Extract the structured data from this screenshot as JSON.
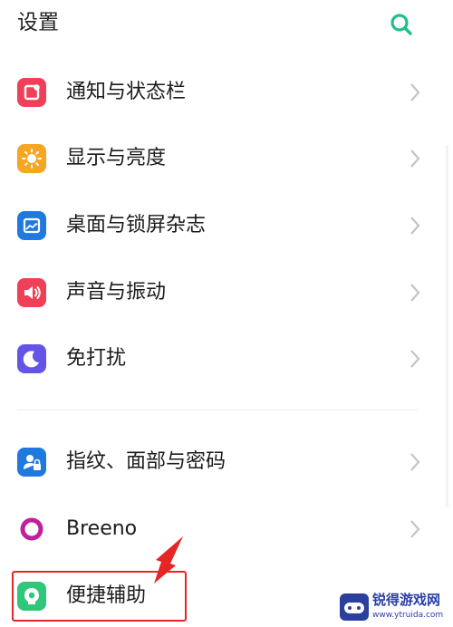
{
  "header": {
    "title": "设置",
    "search_icon": "search-icon"
  },
  "colors": {
    "accent": "#1fbf8f",
    "notification": "#ef4058",
    "display": "#f5a623",
    "wallpaper": "#1f7ae0",
    "sound": "#ef4058",
    "dnd": "#6455e6",
    "fingerprint": "#1f7ae0",
    "breeno": "#c1209b",
    "accessibility": "#2fc77a",
    "highlight": "#e62525"
  },
  "settings": {
    "items": [
      {
        "label": "通知与状态栏",
        "icon": "notification-icon"
      },
      {
        "label": "显示与亮度",
        "icon": "brightness-icon"
      },
      {
        "label": "桌面与锁屏杂志",
        "icon": "wallpaper-icon"
      },
      {
        "label": "声音与振动",
        "icon": "volume-icon"
      },
      {
        "label": "免打扰",
        "icon": "moon-icon"
      },
      {
        "label": "指纹、面部与密码",
        "icon": "fingerprint-face-icon"
      },
      {
        "label": "Breeno",
        "icon": "breeno-icon"
      },
      {
        "label": "便捷辅助",
        "icon": "accessibility-icon"
      }
    ]
  },
  "watermark": {
    "brand": "锐得游戏网",
    "url": "www.ytruida.com"
  }
}
